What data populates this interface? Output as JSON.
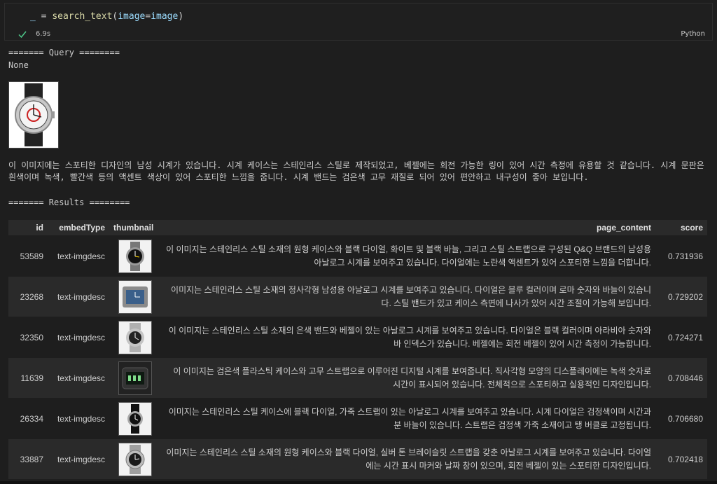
{
  "cell": {
    "code": {
      "underscore": "_",
      "equals": " = ",
      "func": "search_text",
      "arg_open": "(",
      "arg_name": "image",
      "arg_eq": "=",
      "arg_val": "image",
      "arg_close": ")"
    },
    "exec_time": "6.9s",
    "language": "Python",
    "status_icon": "check-icon"
  },
  "output": {
    "query_header": "======= Query ========",
    "query_value": "None",
    "query_image_icon": "watch-image",
    "description": "이 이미지에는 스포티한 디자인의 남성 시계가 있습니다. 시계 케이스는 스테인리스 스틸로 제작되었고, 베젤에는 회전 가능한 링이 있어 시간 측정에 유용할 것 같습니다. 시계 문판은 흰색이며 녹색, 빨간색 등의 액센트 색상이 있어 스포티한 느낌을 줍니다. 시계 밴드는 검은색 고무 재질로 되어 있어 편안하고 내구성이 좋아 보입니다.",
    "results_header": "======= Results ========"
  },
  "table": {
    "headers": {
      "id": "id",
      "embedType": "embedType",
      "thumbnail": "thumbnail",
      "page_content": "page_content",
      "score": "score"
    },
    "rows": [
      {
        "id": "53589",
        "embedType": "text-imgdesc",
        "thumb": "round-watch-black-dial",
        "page_content": "이 이미지는 스테인리스 스틸 소재의 원형 케이스와 블랙 다이얼, 화이트 및 블랙 바늘, 그리고 스틸 스트랩으로 구성된 Q&Q 브랜드의 남성용 아날로그 시계를 보여주고 있습니다. 다이얼에는 노란색 액센트가 있어 스포티한 느낌을 더합니다.",
        "score": "0.731936"
      },
      {
        "id": "23268",
        "embedType": "text-imgdesc",
        "thumb": "rectangular-watch-blue-dial",
        "page_content": "이미지는 스테인리스 스틸 소재의 정사각형 남성용 아날로그 시계를 보여주고 있습니다. 다이얼은 블루 컬러이며 로마 숫자와 바늘이 있습니다. 스틸 밴드가 있고 케이스 측면에 나사가 있어 시간 조절이 가능해 보입니다.",
        "score": "0.729202"
      },
      {
        "id": "32350",
        "embedType": "text-imgdesc",
        "thumb": "round-watch-silver-band",
        "page_content": "이 이미지는 스테인리스 스틸 소재의 은색 밴드와 베젤이 있는 아날로그 시계를 보여주고 있습니다. 다이얼은 블랙 컬러이며 아라비아 숫자와 바 인덱스가 있습니다. 베젤에는 회전 베젤이 있어 시간 측정이 가능합니다.",
        "score": "0.724271"
      },
      {
        "id": "11639",
        "embedType": "text-imgdesc",
        "thumb": "digital-watch",
        "page_content": "이 이미지는 검은색 플라스틱 케이스와 고무 스트랩으로 이루어진 디지털 시계를 보여줍니다. 직사각형 모양의 디스플레이에는 녹색 숫자로 시간이 표시되어 있습니다. 전체적으로 스포티하고 실용적인 디자인입니다.",
        "score": "0.708446"
      },
      {
        "id": "26334",
        "embedType": "text-imgdesc",
        "thumb": "round-watch-leather-strap",
        "page_content": "이미지는 스테인리스 스틸 케이스에 블랙 다이얼, 가죽 스트랩이 있는 아날로그 시계를 보여주고 있습니다. 시계 다이얼은 검정색이며 시간과 분 바늘이 있습니다. 스트랩은 검정색 가죽 소재이고 탱 버클로 고정됩니다.",
        "score": "0.706680"
      },
      {
        "id": "33887",
        "embedType": "text-imgdesc",
        "thumb": "round-watch-silver-bracelet",
        "page_content": "이미지는 스테인리스 스틸 소재의 원형 케이스와 블랙 다이얼, 실버 톤 브레이슬릿 스트랩을 갖춘 아날로그 시계를 보여주고 있습니다. 다이얼에는 시간 표시 마커와 날짜 창이 있으며, 회전 베젤이 있는 스포티한 디자인입니다.",
        "score": "0.702418"
      }
    ]
  },
  "colors": {
    "background": "#1e1e1e",
    "check": "#4ec98a",
    "function": "#dcdcaa",
    "variable": "#9cdcfe"
  }
}
